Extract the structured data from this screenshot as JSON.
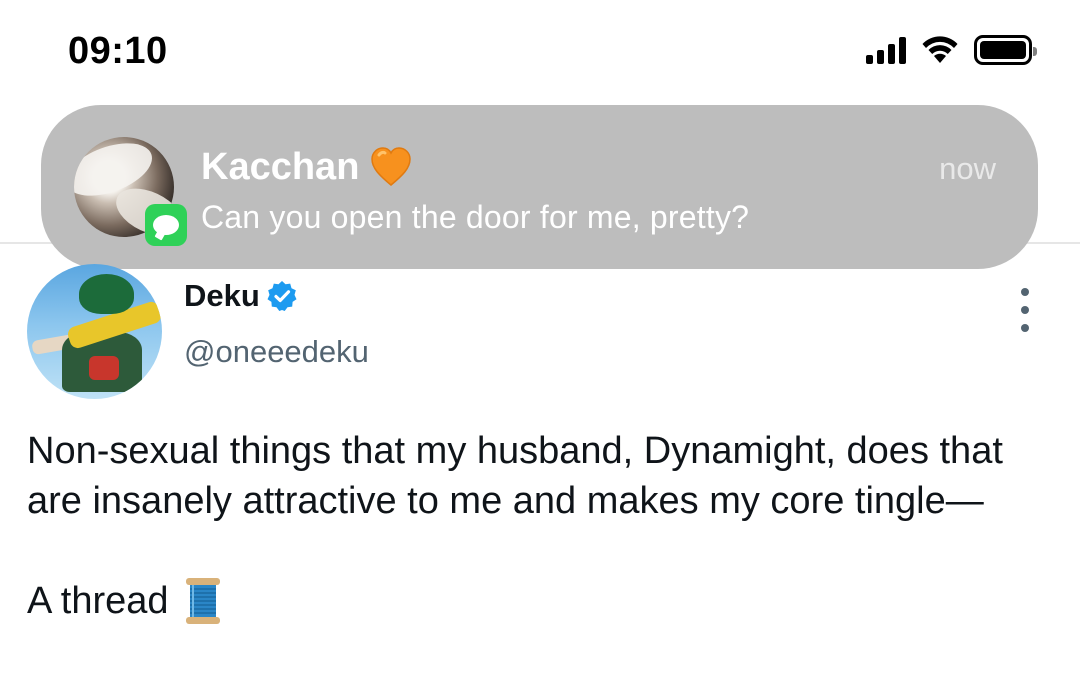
{
  "status_bar": {
    "time": "09:10",
    "icons": [
      "cellular-signal-icon",
      "wifi-icon",
      "battery-icon"
    ]
  },
  "notification": {
    "sender": "Kacchan",
    "sender_emoji": "orange-heart",
    "time": "now",
    "message": "Can you open the door for me, pretty?",
    "app_icon": "messages-icon"
  },
  "tweet": {
    "display_name": "Deku",
    "verified": true,
    "handle": "@oneeedeku",
    "text_line1": "Non-sexual things that my husband, Dynamight, does that are insanely attractive to me and makes my core tingle—",
    "text_line2": "A thread",
    "text_emoji": "spool-of-thread"
  },
  "colors": {
    "notification_bg": "#bdbdbd",
    "verified_blue": "#1d9bf0",
    "handle_gray": "#536471",
    "messages_green": "#2fd158",
    "heart_orange": "#f7911e"
  }
}
